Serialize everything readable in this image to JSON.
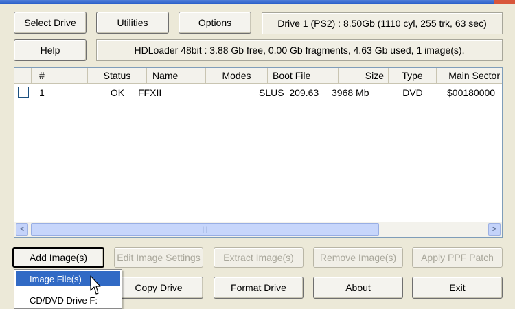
{
  "toolbar": {
    "select_drive": "Select Drive",
    "utilities": "Utilities",
    "options": "Options",
    "help": "Help"
  },
  "drive_info": "Drive 1 (PS2) :  8.50Gb  (1110 cyl, 255 trk, 63 sec)",
  "status_info": "HDLoader 48bit :  3.88 Gb free,  0.00 Gb fragments,  4.63 Gb used,  1 image(s).",
  "list": {
    "columns": [
      "",
      "#",
      "Status",
      "Name",
      "Modes",
      "Boot File",
      "Size",
      "Type",
      "Main Sector"
    ],
    "rows": [
      {
        "num": "1",
        "status": "OK",
        "name": "FFXII",
        "modes": "",
        "boot": "SLUS_209.63",
        "size": "3968 Mb",
        "type": "DVD",
        "sector": "$00180000"
      }
    ],
    "scroll_left": "<",
    "scroll_right": ">",
    "thumb_grip": "|||"
  },
  "actions": {
    "add_images": "Add Image(s)",
    "edit_settings": "Edit Image Settings",
    "extract": "Extract Image(s)",
    "remove": "Remove Image(s)",
    "apply_ppf": "Apply PPF Patch",
    "copy_drive": "Copy Drive",
    "format_drive": "Format Drive",
    "about": "About",
    "exit": "Exit"
  },
  "add_menu": {
    "items": [
      "Image File(s)",
      "CD/DVD Drive F:"
    ]
  },
  "colors": {
    "window_bg": "#ece9d8",
    "selection": "#316ac5",
    "title_bar": "#2a5fc9"
  }
}
